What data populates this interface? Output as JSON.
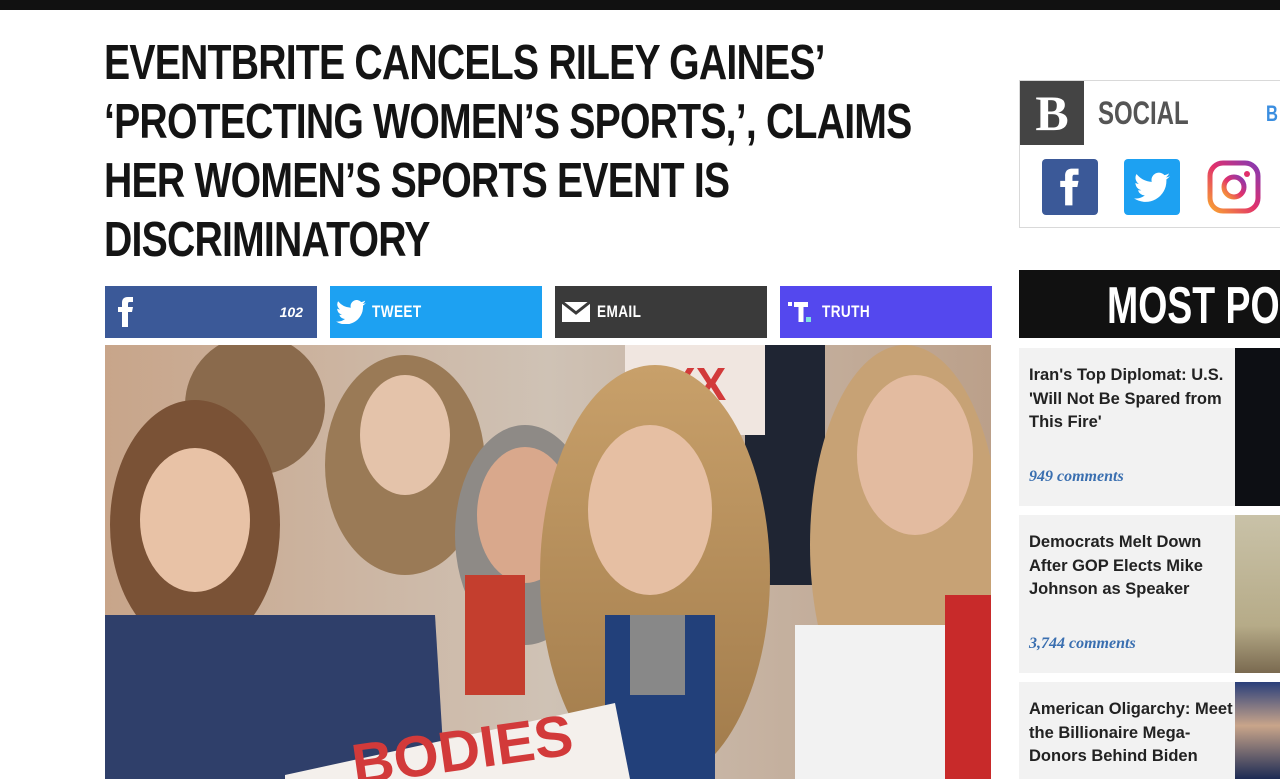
{
  "article": {
    "headline": "EVENTBRITE CANCELS RILEY GAINES’ ‘PROTECTING WOMEN’S SPORTS,’, CLAIMS HER WOMEN’S SPORTS EVENT IS DISCRIMINATORY",
    "headline_lines": [
      "EVENTBRITE CANCELS RILEY GAINES’",
      "‘PROTECTING WOMEN’S SPORTS,’, CLAIMS",
      "HER WOMEN’S SPORTS EVENT IS",
      "DISCRIMINATORY"
    ]
  },
  "share": {
    "facebook_count": "102",
    "twitter_label": "TWEET",
    "email_label": "EMAIL",
    "truth_label": "TRUTH",
    "facebook_icon": "facebook-f-icon",
    "twitter_icon": "twitter-bird-icon",
    "email_icon": "envelope-icon",
    "truth_icon": "truth-social-icon"
  },
  "photo": {
    "sign_text": "BODIES",
    "sign_fragment": "XX"
  },
  "sidebar": {
    "social": {
      "logo_letter": "B",
      "title": "SOCIAL",
      "more_fragment": "B"
    },
    "most_popular_title": "MOST POPU",
    "items": [
      {
        "title": "Iran's Top Diplomat: U.S. 'Will Not Be Spared from This Fire'",
        "comments": "949 comments"
      },
      {
        "title": "Democrats Melt Down After GOP Elects Mike Johnson as Speaker",
        "comments": "3,744 comments"
      },
      {
        "title": "American Oligarchy: Meet the Billionaire Mega-Donors Behind Biden",
        "comments": ""
      }
    ]
  },
  "colors": {
    "facebook": "#3b5998",
    "twitter": "#1da1f2",
    "email": "#3a3a3a",
    "truth": "#5448ee",
    "comments_link": "#3a6fb0"
  }
}
